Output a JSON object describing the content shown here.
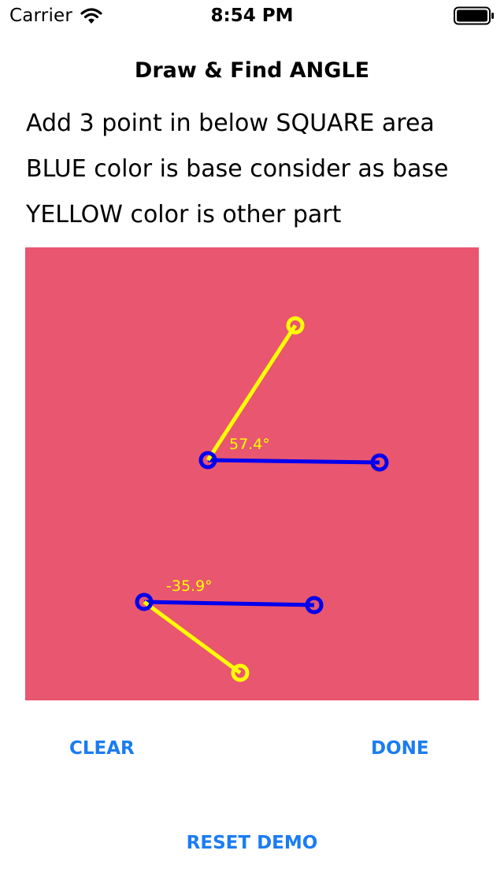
{
  "status_bar": {
    "carrier": "Carrier",
    "time": "8:54 PM",
    "wifi_icon": "wifi-icon",
    "battery_icon": "battery-icon"
  },
  "nav": {
    "title": "Draw & Find ANGLE"
  },
  "instructions": [
    "Add 3 point in below SQUARE area",
    "BLUE color is base consider as base",
    "YELLOW color is other part"
  ],
  "canvas": {
    "background_color": "#e8566f",
    "base_color": "#0000ee",
    "other_color": "#ffff00",
    "angles": [
      {
        "label": "57.4°",
        "value": 57.4
      },
      {
        "label": "-35.9°",
        "value": -35.9
      }
    ]
  },
  "buttons": {
    "clear": "CLEAR",
    "done": "DONE",
    "reset": "RESET DEMO"
  },
  "colors": {
    "accent": "#1b7cf2"
  }
}
